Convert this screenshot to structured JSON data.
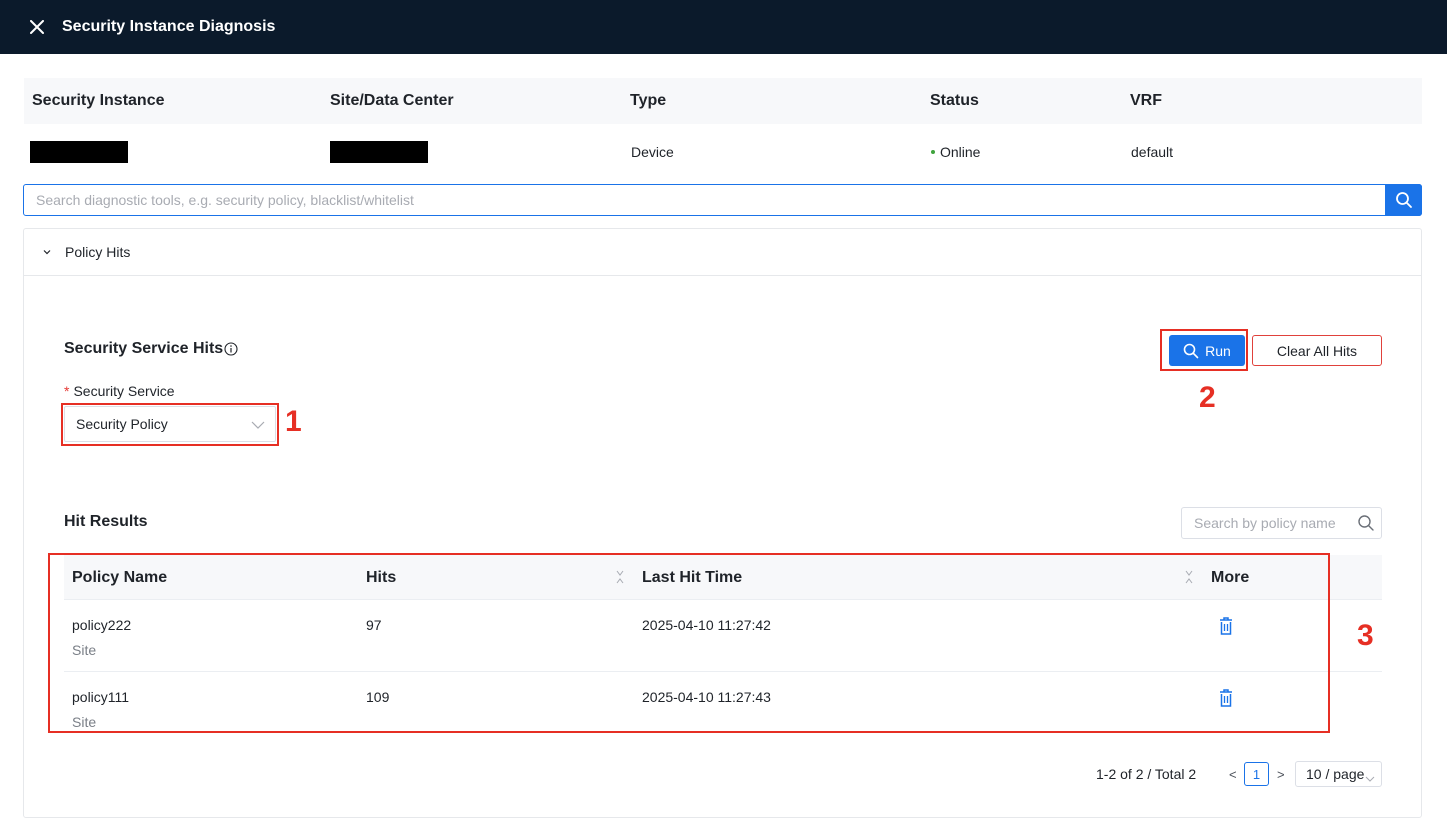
{
  "window": {
    "title": "Security Instance Diagnosis"
  },
  "instance": {
    "headers": [
      "Security Instance",
      "Site/Data Center",
      "Type",
      "Status",
      "VRF"
    ],
    "type": "Device",
    "status": "Online",
    "status_color": "#3fa33d",
    "vrf": "default"
  },
  "search": {
    "placeholder": "Search diagnostic tools, e.g. security policy, blacklist/whitelist"
  },
  "panel": {
    "label": "Policy Hits"
  },
  "service": {
    "title": "Security Service Hits",
    "field_required_mark": "*",
    "field_label": "Security Service",
    "selected": "Security Policy",
    "run_label": "Run",
    "clear_label": "Clear All Hits"
  },
  "results": {
    "title": "Hit Results",
    "search_placeholder": "Search by policy name",
    "columns": [
      "Policy Name",
      "Hits",
      "Last Hit Time",
      "More"
    ],
    "rows": [
      {
        "name": "policy222",
        "scope": "Site",
        "hits": "97",
        "last_hit": "2025-04-10 11:27:42"
      },
      {
        "name": "policy111",
        "scope": "Site",
        "hits": "109",
        "last_hit": "2025-04-10 11:27:43"
      }
    ]
  },
  "pagination": {
    "summary": "1-2 of 2 / Total 2",
    "prev": "<",
    "next": ">",
    "current_page": "1",
    "page_size": "10 / page"
  },
  "annotations": [
    "1",
    "2",
    "3"
  ],
  "colors": {
    "accent": "#1a73e8",
    "titlebar": "#0b1a2b",
    "annotation": "#e62f24"
  }
}
